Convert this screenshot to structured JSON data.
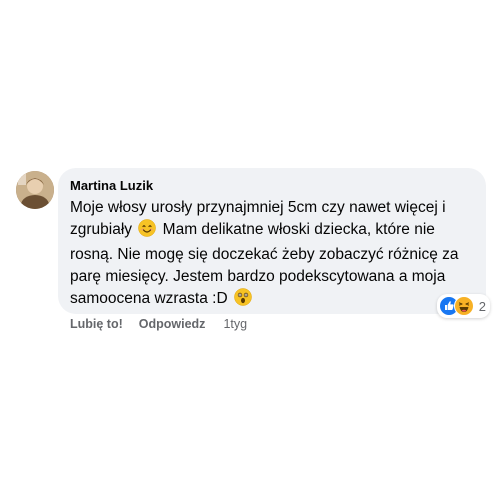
{
  "comment": {
    "author": "Martina Luzik",
    "text_part1": "Moje włosy urosły przynajmniej 5cm czy nawet więcej i zgrubiały",
    "text_part2": "Mam delikatne włoski dziecka, które nie rosną. Nie mogę się doczekać żeby zobaczyć różnicę za parę miesięcy. Jestem bardzo podekscytowana a moja samoocena wzrasta :D",
    "emojis": [
      "smiling-face-emoji",
      "astonished-face-emoji"
    ],
    "reactions": {
      "icons": [
        "like-icon",
        "haha-icon"
      ],
      "count": "2"
    }
  },
  "actions": {
    "like_label": "Lubię to!",
    "reply_label": "Odpowiedz",
    "timestamp": "1tyg"
  },
  "colors": {
    "bubble_bg": "#f0f2f5",
    "text": "#050505",
    "muted": "#65676b",
    "like_blue": "#1877f2",
    "haha_yellow": "#f7b125"
  }
}
